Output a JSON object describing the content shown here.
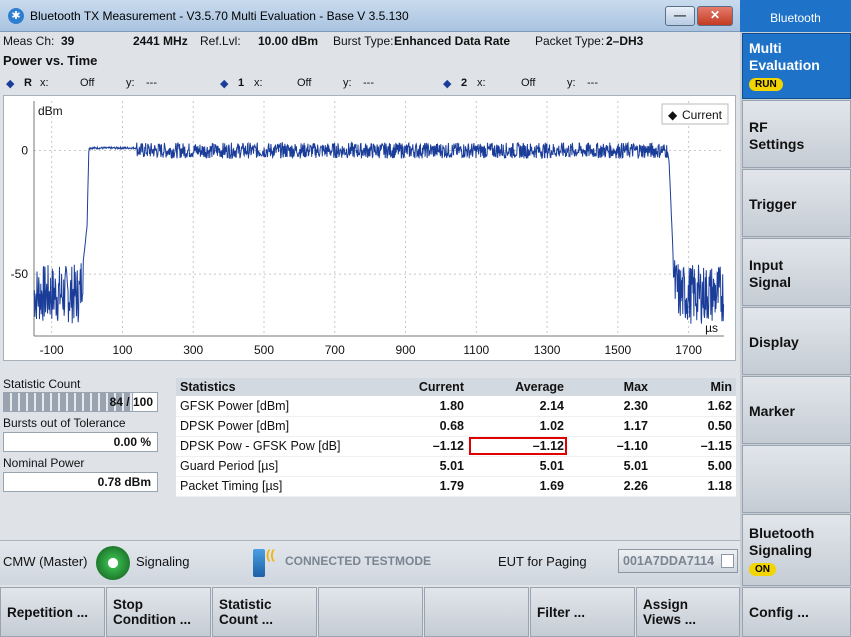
{
  "window": {
    "title": "Bluetooth TX Measurement  - V3.5.70 Multi Evaluation - Base V 3.5.130",
    "min_glyph": "—",
    "close_glyph": "✕"
  },
  "right_panel": {
    "header": "Bluetooth",
    "softkeys": [
      {
        "label": "Multi\nEvaluation",
        "badge": "RUN",
        "active": true
      },
      {
        "label": "RF\nSettings"
      },
      {
        "label": "Trigger"
      },
      {
        "label": "Input\nSignal"
      },
      {
        "label": "Display"
      },
      {
        "label": "Marker"
      },
      {
        "label": ""
      },
      {
        "label": "Bluetooth\nSignaling",
        "badge": "ON"
      },
      {
        "label": "Config ..."
      }
    ]
  },
  "info": {
    "meas_ch_label": "Meas Ch:",
    "meas_ch_value": "39",
    "freq": "2441 MHz",
    "ref_label": "Ref.Lvl:",
    "ref_value": "10.00 dBm",
    "burst_label": "Burst Type:",
    "burst_value": "Enhanced Data Rate",
    "packet_label": "Packet Type:",
    "packet_value": "2–DH3"
  },
  "section_title": "Power vs. Time",
  "markers": [
    {
      "id": "R",
      "x_label": "x:",
      "x": "Off",
      "y_label": "y:",
      "y": "---"
    },
    {
      "id": "1",
      "x_label": "x:",
      "x": "Off",
      "y_label": "y:",
      "y": "---"
    },
    {
      "id": "2",
      "x_label": "x:",
      "x": "Off",
      "y_label": "y:",
      "y": "---"
    }
  ],
  "chart_data": {
    "type": "line",
    "ylabel": "dBm",
    "xlabel": "µs",
    "legend": "Current",
    "legend_position": "top-right",
    "grid": true,
    "xlim": [
      -150,
      1800
    ],
    "ylim": [
      -75,
      20
    ],
    "x_ticks": [
      -100,
      100,
      300,
      500,
      700,
      900,
      1100,
      1300,
      1500,
      1700
    ],
    "y_ticks": [
      0,
      -50
    ],
    "series": [
      {
        "name": "Current",
        "color": "#1b3d9a",
        "x": [
          -150,
          -20,
          0,
          5,
          140,
          145,
          1640,
          1645,
          1660,
          1680,
          1800
        ],
        "y": [
          -58,
          -58,
          -30,
          1,
          1,
          0,
          0,
          -5,
          -55,
          -58,
          -58
        ]
      }
    ]
  },
  "left_stats": {
    "stat_count_label": "Statistic Count",
    "stat_count_value": "84 / 100",
    "stat_fraction": 0.84,
    "bursts_label": "Bursts out of Tolerance",
    "bursts_value": "0.00  %",
    "nominal_label": "Nominal Power",
    "nominal_value": "0.78  dBm"
  },
  "stats_table": {
    "headers": [
      "Statistics",
      "Current",
      "Average",
      "Max",
      "Min"
    ],
    "rows": [
      [
        "GFSK Power [dBm]",
        "1.80",
        "2.14",
        "2.30",
        "1.62"
      ],
      [
        "DPSK Power [dBm]",
        "0.68",
        "1.02",
        "1.17",
        "0.50"
      ],
      [
        "DPSK Pow - GFSK Pow [dB]",
        "–1.12",
        "–1.12",
        "–1.10",
        "–1.15"
      ],
      [
        "Guard Period [µs]",
        "5.01",
        "5.01",
        "5.01",
        "5.00"
      ],
      [
        "Packet Timing [µs]",
        "1.79",
        "1.69",
        "2.26",
        "1.18"
      ]
    ]
  },
  "statusbar": {
    "cmw": "CMW (Master)",
    "signaling": "Signaling",
    "testmode": "CONNECTED TESTMODE",
    "eut_label": "EUT for Paging",
    "eut_value": "001A7DDA7114"
  },
  "bottom_softkeys": [
    "Repetition ...",
    "Stop\nCondition ...",
    "Statistic\nCount ...",
    "",
    "",
    "Filter ...",
    "Assign\nViews ..."
  ],
  "colors": {
    "accent": "#1e73c8",
    "trace": "#1b3d9a",
    "highlight": "#e00000",
    "badge": "#f2d400"
  }
}
